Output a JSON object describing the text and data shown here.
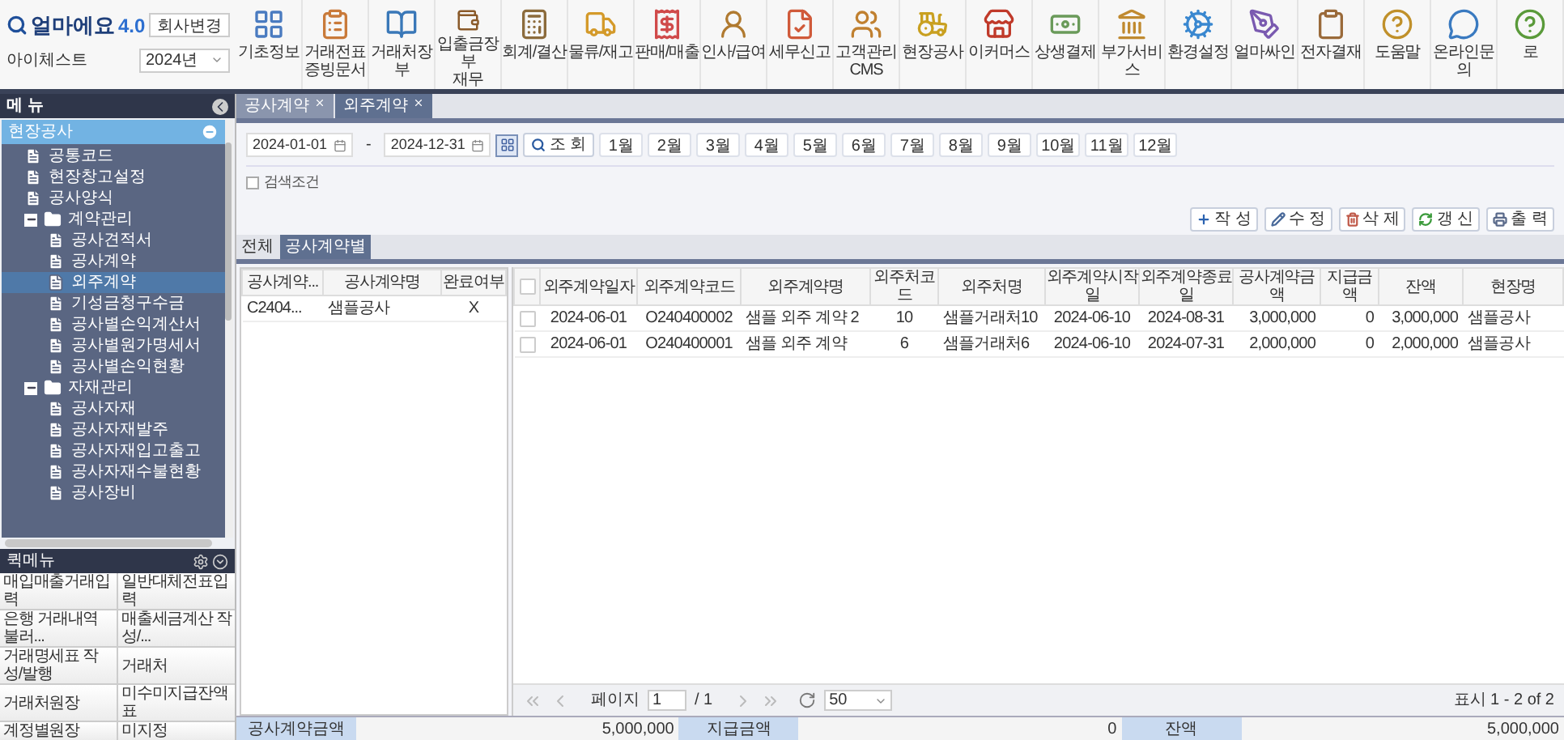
{
  "app": {
    "logo": "얼마에요",
    "version": "4.0",
    "company": "아이체스트",
    "change_company": "회사변경",
    "year": "2024년"
  },
  "top_menu": [
    {
      "label": "기초정보"
    },
    {
      "label": "거래전표\n증빙문서"
    },
    {
      "label": "거래처장부"
    },
    {
      "label": "입출금장부\n재무"
    },
    {
      "label": "회계/결산"
    },
    {
      "label": "물류/재고"
    },
    {
      "label": "판매/매출"
    },
    {
      "label": "인사/급여"
    },
    {
      "label": "세무신고"
    },
    {
      "label": "고객관리\nCMS"
    },
    {
      "label": "현장공사"
    },
    {
      "label": "이커머스"
    },
    {
      "label": "상생결제"
    },
    {
      "label": "부가서비스"
    },
    {
      "label": "환경설정"
    },
    {
      "label": "얼마싸인"
    },
    {
      "label": "전자결재"
    },
    {
      "label": "도움말"
    },
    {
      "label": "온라인문의"
    },
    {
      "label": "로"
    }
  ],
  "sidebar": {
    "title": "메 뉴",
    "tree": [
      {
        "label": "현장공사",
        "kind": "root",
        "expanded": true,
        "selected": false,
        "children": [
          {
            "label": "공통코드",
            "kind": "page",
            "selected": false
          },
          {
            "label": "현장창고설정",
            "kind": "page",
            "selected": false
          },
          {
            "label": "공사양식",
            "kind": "page",
            "selected": false
          },
          {
            "label": "계약관리",
            "kind": "folder",
            "expanded": true,
            "selected": false,
            "children": [
              {
                "label": "공사견적서",
                "kind": "page",
                "selected": false
              },
              {
                "label": "공사계약",
                "kind": "page",
                "selected": false
              },
              {
                "label": "외주계약",
                "kind": "page",
                "selected": true
              },
              {
                "label": "기성금청구수금",
                "kind": "page",
                "selected": false
              },
              {
                "label": "공사별손익계산서",
                "kind": "page",
                "selected": false
              },
              {
                "label": "공사별원가명세서",
                "kind": "page",
                "selected": false
              },
              {
                "label": "공사별손익현황",
                "kind": "page",
                "selected": false
              }
            ]
          },
          {
            "label": "자재관리",
            "kind": "folder",
            "expanded": true,
            "selected": false,
            "children": [
              {
                "label": "공사자재",
                "kind": "page",
                "selected": false
              },
              {
                "label": "공사자재발주",
                "kind": "page",
                "selected": false
              },
              {
                "label": "공사자재입고출고",
                "kind": "page",
                "selected": false
              },
              {
                "label": "공사자재수불현황",
                "kind": "page",
                "selected": false
              },
              {
                "label": "공사장비",
                "kind": "page",
                "selected": false
              }
            ]
          }
        ]
      }
    ],
    "quick_menu": {
      "title": "퀵메뉴",
      "items": [
        "매입매출거래입력",
        "일반대체전표입력",
        "은행 거래내역 불러...",
        "매출세금계산 작성/...",
        "거래명세표 작성/발행",
        "거래처",
        "거래처원장",
        "미수미지급잔액표",
        "계정별원장",
        "미지정"
      ]
    }
  },
  "doc_tabs": [
    {
      "label": "공사계약",
      "selected": false
    },
    {
      "label": "외주계약",
      "selected": true
    }
  ],
  "filter": {
    "date_from": "2024-01-01",
    "separator": "-",
    "date_to": "2024-12-31",
    "search_button": "조 회",
    "months": [
      "1월",
      "2월",
      "3월",
      "4월",
      "5월",
      "6월",
      "7월",
      "8월",
      "9월",
      "10월",
      "11월",
      "12월"
    ],
    "condition": {
      "label": "검색조건",
      "checked": false
    }
  },
  "actions": [
    "작 성",
    "수 정",
    "삭 제",
    "갱 신",
    "출 력"
  ],
  "view_tabs": [
    {
      "label": "전체",
      "selected": false
    },
    {
      "label": "공사계약별",
      "selected": true
    }
  ],
  "contract_table": {
    "columns": [
      "공사계약...",
      "공사계약명",
      "완료여부"
    ],
    "rows": [
      [
        "C2404...",
        "샘플공사",
        "X"
      ]
    ]
  },
  "outsourcing_table": {
    "select_all": {
      "checked": false
    },
    "columns": [
      "외주계약일자",
      "외주계약코드",
      "외주계약명",
      "외주처코드",
      "외주처명",
      "외주계약시작일",
      "외주계약종료일",
      "공사계약금액",
      "지급금액",
      "잔액",
      "현장명"
    ],
    "rows": [
      {
        "checked": false,
        "cells": [
          "2024-06-01",
          "O240400002",
          "샘플 외주 계약 2",
          "10",
          "샘플거래처10",
          "2024-06-10",
          "2024-08-31",
          "3,000,000",
          "0",
          "3,000,000",
          "샘플공사"
        ]
      },
      {
        "checked": false,
        "cells": [
          "2024-06-01",
          "O240400001",
          "샘플 외주 계약",
          "6",
          "샘플거래처6",
          "2024-06-10",
          "2024-07-31",
          "2,000,000",
          "0",
          "2,000,000",
          "샘플공사"
        ]
      }
    ]
  },
  "pager": {
    "page_label": "페이지",
    "page": "1",
    "total": "/ 1",
    "page_size": "50",
    "summary": "표시 1 - 2 of 2"
  },
  "totals": [
    {
      "label": "공사계약금액",
      "value": "5,000,000"
    },
    {
      "label": "지급금액",
      "value": "0"
    },
    {
      "label": "잔액",
      "value": "5,000,000"
    }
  ]
}
